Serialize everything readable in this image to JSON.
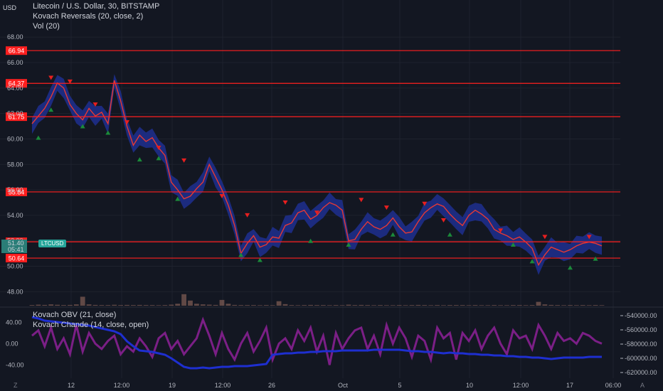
{
  "header": {
    "pair": "USD",
    "title": "Litecoin / U.S. Dollar, 30, BITSTAMP",
    "indicator1": "Kovach Reversals (20, close, 2)",
    "indicator2": "Vol (20)",
    "symbol_badge": "LTCUSD",
    "current_price": "51.40",
    "countdown": "05:41"
  },
  "lower_pane": {
    "indicator1": "Kovach OBV (21, close)",
    "indicator2": "Kovach Chande (14, close, open)"
  },
  "corner_icons": {
    "left": "Z",
    "right": "A"
  },
  "colors": {
    "background": "#131722",
    "grid": "#1e222d",
    "axis_text": "#b2b5be",
    "price_line": "#e53935",
    "band": "#1e2f8f",
    "support_resistance": "#ff1f1f",
    "bull_marker": "#1b8a3a",
    "bear_marker": "#e81f1f",
    "chande": "#7b1f86",
    "obv": "#1e2fd0",
    "volume": "#f3a58a"
  },
  "chart_data": [
    {
      "type": "line",
      "title": "Litecoin / U.S. Dollar, 30, BITSTAMP",
      "xlabel": "",
      "ylabel": "USD",
      "x_ticks": [
        "12",
        "12:00",
        "19",
        "12:00",
        "26",
        "Oct",
        "5",
        "10",
        "12:00",
        "17",
        "06:00"
      ],
      "y_ticks": [
        48.0,
        50.0,
        52.0,
        54.0,
        56.0,
        58.0,
        60.0,
        62.0,
        64.0,
        66.0,
        68.0
      ],
      "ylim": [
        46.9,
        69.8
      ],
      "grid": true,
      "levels": [
        66.94,
        64.37,
        61.75,
        55.84,
        51.92,
        50.64
      ],
      "series": [
        {
          "name": "Litecoin / U.S. Dollar",
          "values": [
            61.2,
            61.8,
            62.4,
            63.3,
            64.4,
            64.0,
            62.7,
            62.0,
            61.5,
            62.4,
            61.8,
            62.1,
            61.2,
            64.6,
            63.0,
            61.0,
            59.5,
            60.3,
            59.8,
            60.1,
            59.3,
            58.7,
            56.6,
            56.0,
            55.3,
            55.5,
            56.1,
            56.6,
            58.0,
            57.0,
            56.0,
            54.8,
            53.2,
            51.0,
            51.8,
            52.4,
            51.5,
            51.7,
            52.3,
            52.2,
            53.2,
            53.4,
            54.2,
            54.4,
            53.7,
            54.0,
            54.6,
            55.0,
            54.8,
            54.4,
            52.0,
            52.1,
            52.9,
            53.5,
            53.1,
            52.9,
            53.2,
            53.8,
            53.1,
            52.6,
            52.7,
            53.5,
            54.2,
            54.6,
            54.9,
            54.7,
            54.1,
            53.6,
            53.2,
            54.0,
            54.4,
            54.1,
            53.7,
            52.9,
            52.6,
            52.4,
            52.1,
            52.3,
            51.9,
            51.4,
            50.1,
            50.9,
            51.5,
            51.3,
            51.1,
            51.3,
            51.6,
            51.8,
            51.9,
            51.8,
            51.6
          ]
        }
      ],
      "markers_up": [
        [
          1,
          60.1
        ],
        [
          3,
          62.3
        ],
        [
          8,
          61.0
        ],
        [
          12,
          60.5
        ],
        [
          17,
          58.4
        ],
        [
          20,
          58.5
        ],
        [
          23,
          55.3
        ],
        [
          33,
          50.9
        ],
        [
          36,
          50.5
        ],
        [
          44,
          52.0
        ],
        [
          50,
          51.7
        ],
        [
          57,
          52.5
        ],
        [
          66,
          52.5
        ],
        [
          76,
          51.7
        ],
        [
          79,
          50.4
        ],
        [
          85,
          49.9
        ],
        [
          89,
          50.6
        ]
      ],
      "markers_down": [
        [
          3,
          64.8
        ],
        [
          6,
          64.5
        ],
        [
          10,
          62.7
        ],
        [
          15,
          61.3
        ],
        [
          20,
          59.3
        ],
        [
          24,
          58.3
        ],
        [
          30,
          55.5
        ],
        [
          34,
          54.0
        ],
        [
          40,
          55.0
        ],
        [
          45,
          54.2
        ],
        [
          52,
          55.2
        ],
        [
          56,
          54.6
        ],
        [
          62,
          54.9
        ],
        [
          65,
          53.6
        ],
        [
          74,
          52.8
        ],
        [
          81,
          52.3
        ],
        [
          88,
          52.3
        ]
      ],
      "volume": [
        0.05,
        0.08,
        0.06,
        0.1,
        0.07,
        0.05,
        0.06,
        0.1,
        0.7,
        0.1,
        0.06,
        0.05,
        0.05,
        0.07,
        0.05,
        0.06,
        0.05,
        0.06,
        0.05,
        0.05,
        0.04,
        0.05,
        0.08,
        0.15,
        0.9,
        0.4,
        0.15,
        0.1,
        0.08,
        0.06,
        0.45,
        0.15,
        0.06,
        0.05,
        0.05,
        0.05,
        0.04,
        0.05,
        0.04,
        0.35,
        0.12,
        0.05,
        0.04,
        0.05,
        0.06,
        0.05,
        0.05,
        0.04,
        0.05,
        0.04,
        0.08,
        0.05,
        0.06,
        0.05,
        0.04,
        0.05,
        0.04,
        0.04,
        0.05,
        0.04,
        0.05,
        0.06,
        0.05,
        0.04,
        0.05,
        0.04,
        0.05,
        0.05,
        0.05,
        0.04,
        0.05,
        0.04,
        0.04,
        0.05,
        0.04,
        0.04,
        0.05,
        0.05,
        0.04,
        0.05,
        0.3,
        0.1,
        0.06,
        0.05,
        0.04,
        0.05,
        0.04,
        0.05,
        0.04,
        0.05,
        0.04
      ]
    },
    {
      "type": "line",
      "title": "Kovach Chande (14, close, open)",
      "y_ticks": [
        -40.0,
        0.0,
        40.0
      ],
      "ylim": [
        -65,
        62
      ],
      "series": [
        {
          "name": "Kovach Chande (14, close, open)",
          "values": [
            15,
            25,
            -5,
            30,
            -10,
            10,
            -20,
            35,
            -15,
            20,
            0,
            -10,
            5,
            15,
            -20,
            -5,
            -15,
            10,
            -5,
            -25,
            10,
            20,
            -10,
            5,
            -20,
            -5,
            10,
            45,
            15,
            -20,
            20,
            -10,
            -30,
            0,
            20,
            -15,
            5,
            30,
            -30,
            0,
            10,
            -10,
            25,
            5,
            30,
            -15,
            15,
            -40,
            20,
            -10,
            10,
            25,
            30,
            -10,
            15,
            -20,
            35,
            0,
            30,
            10,
            -25,
            15,
            5,
            -30,
            30,
            10,
            20,
            -30,
            20,
            5,
            25,
            -10,
            15,
            30,
            0,
            -20,
            25,
            10,
            15,
            -10,
            35,
            15,
            -10,
            20,
            5,
            10,
            0,
            20,
            15,
            5,
            0
          ]
        }
      ]
    },
    {
      "type": "line",
      "title": "Kovach OBV (21, close)",
      "y_ticks": [
        -540000.0,
        -560000.0,
        -580000.0,
        -600000.0,
        -620000.0
      ],
      "ylim": [
        -628000,
        -533000
      ],
      "series": [
        {
          "name": "Kovach OBV (21, close)",
          "values": [
            -542000,
            -544000,
            -547000,
            -548000,
            -549000,
            -550000,
            -551000,
            -552000,
            -553000,
            -554000,
            -556000,
            -558000,
            -560000,
            -562000,
            -566000,
            -576000,
            -583000,
            -589000,
            -590000,
            -591000,
            -593000,
            -595000,
            -600000,
            -606000,
            -612000,
            -614000,
            -614000,
            -613000,
            -614000,
            -613000,
            -612000,
            -612000,
            -611000,
            -611000,
            -611000,
            -610000,
            -609000,
            -608000,
            -595000,
            -594000,
            -593000,
            -593000,
            -592000,
            -592000,
            -591000,
            -591000,
            -590000,
            -590000,
            -590000,
            -589000,
            -589000,
            -589000,
            -589000,
            -589000,
            -588000,
            -588000,
            -588000,
            -588000,
            -588000,
            -589000,
            -590000,
            -590000,
            -591000,
            -591000,
            -592000,
            -593000,
            -592000,
            -593000,
            -593000,
            -594000,
            -594000,
            -595000,
            -595000,
            -596000,
            -596000,
            -597000,
            -597000,
            -598000,
            -598000,
            -599000,
            -599000,
            -600000,
            -601000,
            -600000,
            -599000,
            -599000,
            -599000,
            -599000,
            -598000,
            -598000,
            -598000
          ]
        }
      ]
    }
  ]
}
